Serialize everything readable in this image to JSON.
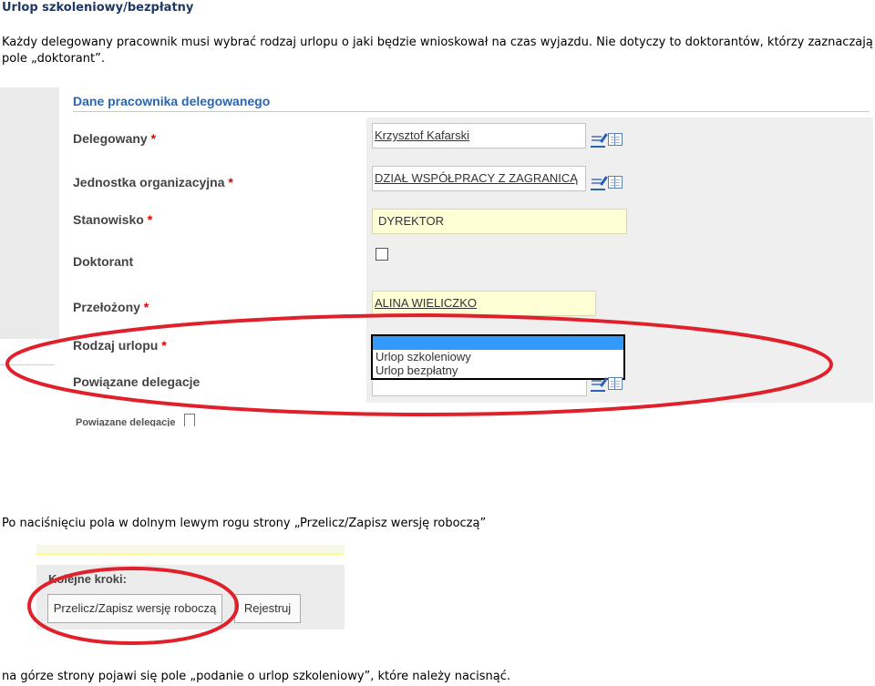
{
  "doc": {
    "heading": "Urlop szkoleniowy/bezpłatny",
    "p1": "Każdy delegowany pracownik musi wybrać rodzaj urlopu o jaki będzie wnioskował na czas wyjazdu. Nie dotyczy to doktorantów, którzy zaznaczają pole „doktorant”.",
    "p2": "Po naciśnięciu pola w dolnym lewym rogu strony „Przelicz/Zapisz wersję roboczą”",
    "p3": "na górze strony pojawi się pole „podanie o urlop szkoleniowy”, które należy nacisnąć."
  },
  "form": {
    "section_title": "Dane pracownika delegowanego",
    "required_mark": "*",
    "labels": {
      "delegowany": "Delegowany",
      "jednostka": "Jednostka organizacyjna",
      "stanowisko": "Stanowisko",
      "doktorant": "Doktorant",
      "przelozony": "Przełożony",
      "rodzaj_urlopu": "Rodzaj urlopu",
      "powiazane": "Powiązane delegacje"
    },
    "values": {
      "delegowany": "Krzysztof Kafarski",
      "jednostka": "DZIAŁ WSPÓŁPRACY Z ZAGRANICĄ",
      "stanowisko": "DYREKTOR",
      "przelozony": "ALINA WIELICZKO"
    },
    "doktorant_checked": false,
    "rodzaj_urlopu_options": [
      "",
      "Urlop szkoleniowy",
      "Urlop bezpłatny"
    ],
    "bottom_link": "Powiązane delegacje"
  },
  "steps": {
    "title": "Kolejne kroki:",
    "save_button": "Przelicz/Zapisz wersję roboczą",
    "register_button": "Rejestruj"
  },
  "colors": {
    "section_title": "#2766b5",
    "highlight_red": "#e0202a",
    "required": "#dd0000",
    "selected_option": "#3399ff",
    "yellow_field": "#ffffd5"
  }
}
